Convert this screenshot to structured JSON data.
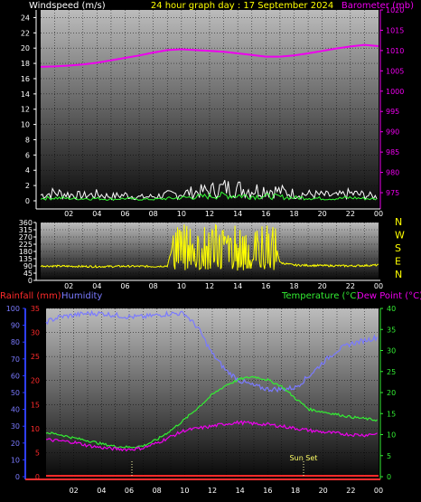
{
  "header": {
    "windspeed_label": "Windspeed (m/s)",
    "date_label": "24 hour graph day : 17 September 2024",
    "barometer_label": "Barometer (mb)"
  },
  "colors": {
    "windspeed_axis": "#ffffff",
    "wind_gust": "#ffffff",
    "wind_avg": "#33ff33",
    "barometer": "#ee00ee",
    "direction": "#ffff00",
    "rainfall": "#ff2a2a",
    "humidity": "#7a7aff",
    "temperature": "#33ee33",
    "dewpoint": "#ee00ee",
    "date_title": "#ffff00",
    "y_axis_line": "#2f3fff",
    "x_axis_line": "#ff3030",
    "temp_axis_ticks": "#33ee33"
  },
  "chart_data": [
    {
      "id": "wind-baro",
      "type": "line",
      "title": "24 hour graph day : 17 September 2024",
      "x_tick_labels": [
        "02",
        "04",
        "06",
        "08",
        "10",
        "12",
        "14",
        "16",
        "18",
        "20",
        "22",
        "00"
      ],
      "left_axis": {
        "label": "Windspeed (m/s)",
        "ylim": [
          0,
          25
        ],
        "ticks": [
          0,
          2,
          4,
          6,
          8,
          10,
          12,
          14,
          16,
          18,
          20,
          22,
          24
        ]
      },
      "right_axis": {
        "label": "Barometer (mb)",
        "ylim": [
          973,
          1020
        ],
        "ticks": [
          975,
          980,
          985,
          990,
          995,
          1000,
          1005,
          1010,
          1015,
          1020
        ]
      },
      "series": [
        {
          "name": "Barometer (mb)",
          "axis": "right",
          "x": [
            0,
            1,
            2,
            3,
            4,
            5,
            6,
            7,
            8,
            9,
            10,
            11,
            12,
            13,
            14,
            15,
            16,
            17,
            18,
            19,
            20,
            21,
            22,
            23,
            24
          ],
          "values": [
            1006.0,
            1006.1,
            1006.3,
            1006.6,
            1007.0,
            1007.6,
            1008.2,
            1008.8,
            1009.5,
            1010.1,
            1010.3,
            1010.1,
            1009.9,
            1009.7,
            1009.3,
            1008.9,
            1008.5,
            1008.5,
            1008.8,
            1009.3,
            1009.9,
            1010.5,
            1011.0,
            1011.4,
            1011.1
          ]
        },
        {
          "name": "gust",
          "x": [
            0,
            1,
            2,
            3,
            4,
            5,
            6,
            7,
            8,
            9,
            10,
            11,
            12,
            13,
            14,
            15,
            16,
            17,
            18,
            19,
            20,
            21,
            22,
            23,
            24
          ],
          "values": [
            0.8,
            1.1,
            0.9,
            0.7,
            0.9,
            0.6,
            0.8,
            0.5,
            0.6,
            0.8,
            1.0,
            1.2,
            1.4,
            1.8,
            1.7,
            1.5,
            1.6,
            1.3,
            1.0,
            0.9,
            0.8,
            0.7,
            1.0,
            0.8,
            0.5
          ]
        },
        {
          "name": "average",
          "x": [
            0,
            1,
            2,
            3,
            4,
            5,
            6,
            7,
            8,
            9,
            10,
            11,
            12,
            13,
            14,
            15,
            16,
            17,
            18,
            19,
            20,
            21,
            22,
            23,
            24
          ],
          "values": [
            0.3,
            0.4,
            0.3,
            0.3,
            0.3,
            0.2,
            0.3,
            0.2,
            0.2,
            0.3,
            0.4,
            0.5,
            0.6,
            0.7,
            0.7,
            0.6,
            0.6,
            0.5,
            0.4,
            0.4,
            0.3,
            0.3,
            0.4,
            0.3,
            0.2
          ]
        }
      ]
    },
    {
      "id": "direction",
      "type": "line",
      "x_tick_labels": [
        "02",
        "04",
        "06",
        "08",
        "10",
        "12",
        "14",
        "16",
        "18",
        "20",
        "22",
        "00"
      ],
      "left_axis": {
        "ylim": [
          0,
          360
        ],
        "ticks": [
          0,
          45,
          90,
          135,
          180,
          225,
          270,
          315,
          360
        ]
      },
      "right_labels": [
        "N",
        "W",
        "S",
        "E",
        "N"
      ],
      "series": [
        {
          "name": "direction",
          "x": [
            0,
            2,
            4,
            6,
            8,
            9,
            9.5,
            10,
            10.5,
            11,
            11.5,
            12,
            12.5,
            13,
            13.5,
            14,
            14.5,
            15,
            15.5,
            16,
            16.5,
            17,
            18,
            20,
            22,
            24
          ],
          "values": [
            90,
            88,
            86,
            88,
            87,
            90,
            250,
            120,
            300,
            110,
            280,
            90,
            320,
            140,
            260,
            100,
            330,
            130,
            270,
            110,
            300,
            110,
            95,
            92,
            90,
            95
          ]
        }
      ]
    },
    {
      "id": "rain-hum-temp",
      "type": "line",
      "x_tick_labels": [
        "02",
        "04",
        "06",
        "08",
        "10",
        "12",
        "14",
        "16",
        "18",
        "20",
        "22",
        "00"
      ],
      "left_axis_rain": {
        "label": "Rainfall (mm)",
        "ylim": [
          0,
          35
        ],
        "ticks": [
          0,
          5,
          10,
          15,
          20,
          25,
          30,
          35
        ]
      },
      "left_axis_humidity": {
        "label": "Humidity",
        "ylim": [
          0,
          100
        ],
        "ticks": [
          0,
          10,
          20,
          30,
          40,
          50,
          60,
          70,
          80,
          90,
          100
        ]
      },
      "right_axis": {
        "label": "Temperature (°C)",
        "label2": "Dew Point (°C)",
        "ylim": [
          0,
          40
        ],
        "ticks": [
          0,
          5,
          10,
          15,
          20,
          25,
          30,
          35,
          40
        ]
      },
      "annotation": "Sun Set",
      "series": [
        {
          "name": "Rainfall (mm)",
          "axis": "rain",
          "x": [
            0,
            24
          ],
          "values": [
            0,
            0
          ]
        },
        {
          "name": "Humidity",
          "axis": "humidity",
          "x": [
            0,
            1,
            2,
            3,
            4,
            5,
            6,
            7,
            8,
            9,
            10,
            11,
            12,
            13,
            14,
            15,
            16,
            17,
            18,
            19,
            20,
            21,
            22,
            23,
            24
          ],
          "values": [
            92,
            95,
            96,
            97,
            97,
            96,
            95,
            95,
            96,
            97,
            97,
            88,
            73,
            63,
            57,
            54,
            52,
            52,
            53,
            60,
            68,
            75,
            79,
            81,
            83
          ]
        },
        {
          "name": "Temperature (°C)",
          "axis": "right",
          "x": [
            0,
            1,
            2,
            3,
            4,
            5,
            6,
            7,
            8,
            9,
            10,
            11,
            12,
            13,
            14,
            15,
            16,
            17,
            18,
            19,
            20,
            21,
            22,
            23,
            24
          ],
          "values": [
            10.5,
            10.0,
            9.2,
            8.6,
            7.8,
            7.2,
            7.0,
            7.3,
            8.8,
            11.0,
            13.6,
            16.5,
            19.5,
            21.8,
            23.2,
            23.8,
            23.0,
            21.5,
            18.6,
            16.0,
            15.4,
            14.8,
            14.2,
            13.8,
            13.4
          ]
        },
        {
          "name": "Dew Point (°C)",
          "axis": "right",
          "x": [
            0,
            1,
            2,
            3,
            4,
            5,
            6,
            7,
            8,
            9,
            10,
            11,
            12,
            13,
            14,
            15,
            16,
            17,
            18,
            19,
            20,
            21,
            22,
            23,
            24
          ],
          "values": [
            8.8,
            8.5,
            8.2,
            7.4,
            6.9,
            6.6,
            6.5,
            6.8,
            8.0,
            9.5,
            11.0,
            11.5,
            12.0,
            12.6,
            12.9,
            12.6,
            12.4,
            12.0,
            11.5,
            11.0,
            10.6,
            10.3,
            10.0,
            9.9,
            10.3
          ]
        }
      ]
    }
  ]
}
